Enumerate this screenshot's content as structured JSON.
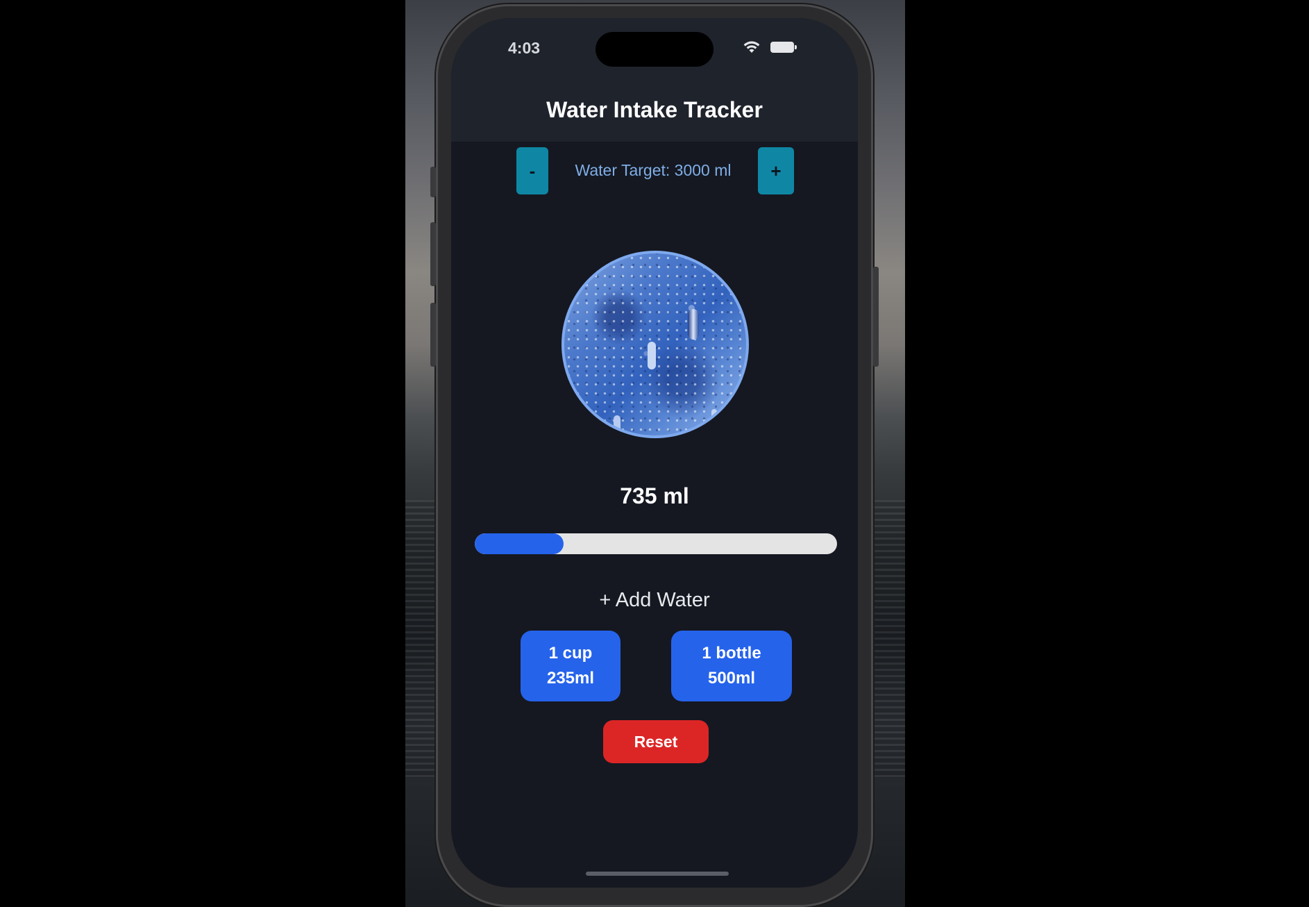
{
  "status_bar": {
    "time": "4:03",
    "icons": [
      "wifi-icon",
      "battery-icon"
    ]
  },
  "header": {
    "title": "Water Intake Tracker"
  },
  "target": {
    "decrease_label": "-",
    "label": "Water Target: 3000 ml",
    "increase_label": "+"
  },
  "intake": {
    "amount": "735 ml",
    "progress_fraction": 0.245
  },
  "add_water": {
    "heading": "+ Add Water",
    "options": [
      {
        "line1": "1 cup",
        "line2": "235ml"
      },
      {
        "line1": "1 bottle",
        "line2": "500ml"
      }
    ]
  },
  "reset_label": "Reset",
  "colors": {
    "background": "#151821",
    "header": "#1f232c",
    "stepper": "#0f87a4",
    "target_text": "#7faee6",
    "accent_blue": "#2563eb",
    "progress_track": "#e4e4e4",
    "reset_red": "#dc2626"
  }
}
